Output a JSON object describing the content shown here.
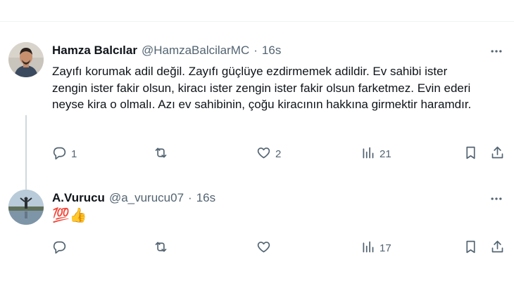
{
  "tweets": [
    {
      "name": "Hamza Balcılar",
      "handle": "@HamzaBalcilarMC",
      "dot": "·",
      "time": "16s",
      "text": "Zayıfı korumak adil değil. Zayıfı güçlüye ezdirmemek adildir. Ev sahibi ister zengin ister fakir olsun, kiracı ister zengin ister fakir olsun farketmez.  Evin ederi neyse kira o olmalı. Azı ev sahibinin, çoğu kiracının hakkına girmektir haramdır.",
      "replies": "1",
      "retweets": "",
      "likes": "2",
      "views": "21"
    },
    {
      "name": "A.Vurucu",
      "handle": "@a_vurucu07",
      "dot": "·",
      "time": "16s",
      "text": "💯👍",
      "replies": "",
      "retweets": "",
      "likes": "",
      "views": "17"
    }
  ],
  "icons": {
    "reply": "reply-icon",
    "retweet": "retweet-icon",
    "like": "like-icon",
    "views": "views-icon",
    "bookmark": "bookmark-icon",
    "share": "share-icon",
    "more": "more-icon"
  },
  "colors": {
    "text": "#0f1419",
    "muted": "#536471",
    "divider": "#cfd9de"
  }
}
